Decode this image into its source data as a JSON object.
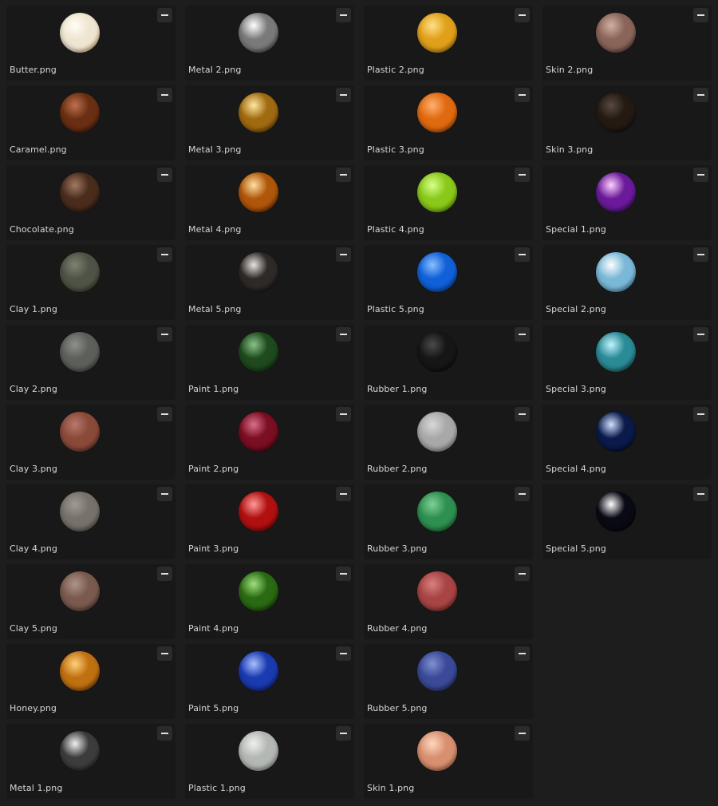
{
  "materials": [
    {
      "label": "Butter.png",
      "color": "#efe6d2",
      "highlight": "#fffdf5",
      "shadow": "#b48a3c"
    },
    {
      "label": "Caramel.png",
      "color": "#6a2f12",
      "highlight": "#c07050",
      "shadow": "#2a0e04"
    },
    {
      "label": "Chocolate.png",
      "color": "#4a2c1c",
      "highlight": "#a07a62",
      "shadow": "#1a0d06"
    },
    {
      "label": "Clay 1.png",
      "color": "#4f5346",
      "highlight": "#7d8271",
      "shadow": "#2a2c24"
    },
    {
      "label": "Clay 2.png",
      "color": "#5d5f5a",
      "highlight": "#8e908a",
      "shadow": "#30312e"
    },
    {
      "label": "Clay 3.png",
      "color": "#8a4a3a",
      "highlight": "#b8786a",
      "shadow": "#4a2018"
    },
    {
      "label": "Clay 4.png",
      "color": "#77716a",
      "highlight": "#a09a92",
      "shadow": "#3e3a35"
    },
    {
      "label": "Clay 5.png",
      "color": "#7a5a4e",
      "highlight": "#b09488",
      "shadow": "#3a2820"
    },
    {
      "label": "Honey.png",
      "color": "#c07010",
      "highlight": "#ffd07a",
      "shadow": "#3a1a00"
    },
    {
      "label": "Metal 1.png",
      "color": "#3c3c3c",
      "highlight": "#f0f0f0",
      "shadow": "#0c0c0c"
    },
    {
      "label": "Metal 2.png",
      "color": "#7a7a7a",
      "highlight": "#ffffff",
      "shadow": "#1c1c1c"
    },
    {
      "label": "Metal 3.png",
      "color": "#a06a10",
      "highlight": "#ffe7a0",
      "shadow": "#3a2000"
    },
    {
      "label": "Metal 4.png",
      "color": "#b0560a",
      "highlight": "#ffe0a0",
      "shadow": "#3a1400"
    },
    {
      "label": "Metal 5.png",
      "color": "#2e2a28",
      "highlight": "#e8e4e0",
      "shadow": "#0a0808"
    },
    {
      "label": "Paint 1.png",
      "color": "#1e4a1e",
      "highlight": "#8ac28a",
      "shadow": "#071807"
    },
    {
      "label": "Paint 2.png",
      "color": "#7a0e22",
      "highlight": "#d8708a",
      "shadow": "#2a0008"
    },
    {
      "label": "Paint 3.png",
      "color": "#b01010",
      "highlight": "#ff9a9a",
      "shadow": "#3a0000"
    },
    {
      "label": "Paint 4.png",
      "color": "#2a6a12",
      "highlight": "#a0e080",
      "shadow": "#0a2204"
    },
    {
      "label": "Paint 5.png",
      "color": "#1a3ab0",
      "highlight": "#a8c0ff",
      "shadow": "#06124a"
    },
    {
      "label": "Plastic 1.png",
      "color": "#b4b8b4",
      "highlight": "#eef0ee",
      "shadow": "#6a6e6a"
    },
    {
      "label": "Plastic 2.png",
      "color": "#e0a01a",
      "highlight": "#ffe08a",
      "shadow": "#8a5a00"
    },
    {
      "label": "Plastic 3.png",
      "color": "#e06a10",
      "highlight": "#ffb070",
      "shadow": "#7a2e00"
    },
    {
      "label": "Plastic 4.png",
      "color": "#8ac81a",
      "highlight": "#d8ff8a",
      "shadow": "#3e6a00"
    },
    {
      "label": "Plastic 5.png",
      "color": "#1060d8",
      "highlight": "#8ac0ff",
      "shadow": "#00246a"
    },
    {
      "label": "Rubber 1.png",
      "color": "#161616",
      "highlight": "#4a4a4a",
      "shadow": "#040404"
    },
    {
      "label": "Rubber 2.png",
      "color": "#a8a8a8",
      "highlight": "#d8d8d8",
      "shadow": "#606060"
    },
    {
      "label": "Rubber 3.png",
      "color": "#2e9050",
      "highlight": "#80d098",
      "shadow": "#0e4422"
    },
    {
      "label": "Rubber 4.png",
      "color": "#a84444",
      "highlight": "#d88080",
      "shadow": "#501818"
    },
    {
      "label": "Rubber 5.png",
      "color": "#3a4a98",
      "highlight": "#8090d0",
      "shadow": "#141c48"
    },
    {
      "label": "Skin 1.png",
      "color": "#d89070",
      "highlight": "#ffd8c0",
      "shadow": "#8a4a30"
    },
    {
      "label": "Skin 2.png",
      "color": "#8a6458",
      "highlight": "#d0b0a4",
      "shadow": "#3a2620"
    },
    {
      "label": "Skin 3.png",
      "color": "#241a14",
      "highlight": "#5a4a40",
      "shadow": "#080404"
    },
    {
      "label": "Special 1.png",
      "color": "#6a1a9a",
      "highlight": "#ffd0ff",
      "shadow": "#14043a"
    },
    {
      "label": "Special 2.png",
      "color": "#7ab8d8",
      "highlight": "#ffffff",
      "shadow": "#2a6080"
    },
    {
      "label": "Special 3.png",
      "color": "#2a8a96",
      "highlight": "#c0f4ff",
      "shadow": "#062a30"
    },
    {
      "label": "Special 4.png",
      "color": "#0a1a4a",
      "highlight": "#d0e0ff",
      "shadow": "#020410"
    },
    {
      "label": "Special 5.png",
      "color": "#0a0a14",
      "highlight": "#ffffff",
      "shadow": "#000000"
    }
  ]
}
